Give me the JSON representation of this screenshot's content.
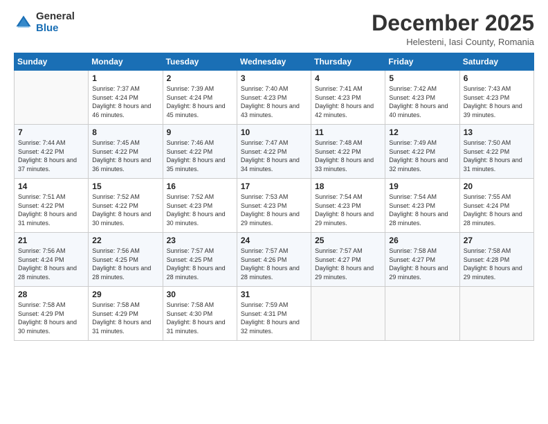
{
  "logo": {
    "general": "General",
    "blue": "Blue"
  },
  "title": "December 2025",
  "location": "Helesteni, Iasi County, Romania",
  "days_of_week": [
    "Sunday",
    "Monday",
    "Tuesday",
    "Wednesday",
    "Thursday",
    "Friday",
    "Saturday"
  ],
  "weeks": [
    [
      {
        "day": "",
        "sunrise": "",
        "sunset": "",
        "daylight": ""
      },
      {
        "day": "1",
        "sunrise": "Sunrise: 7:37 AM",
        "sunset": "Sunset: 4:24 PM",
        "daylight": "Daylight: 8 hours and 46 minutes."
      },
      {
        "day": "2",
        "sunrise": "Sunrise: 7:39 AM",
        "sunset": "Sunset: 4:24 PM",
        "daylight": "Daylight: 8 hours and 45 minutes."
      },
      {
        "day": "3",
        "sunrise": "Sunrise: 7:40 AM",
        "sunset": "Sunset: 4:23 PM",
        "daylight": "Daylight: 8 hours and 43 minutes."
      },
      {
        "day": "4",
        "sunrise": "Sunrise: 7:41 AM",
        "sunset": "Sunset: 4:23 PM",
        "daylight": "Daylight: 8 hours and 42 minutes."
      },
      {
        "day": "5",
        "sunrise": "Sunrise: 7:42 AM",
        "sunset": "Sunset: 4:23 PM",
        "daylight": "Daylight: 8 hours and 40 minutes."
      },
      {
        "day": "6",
        "sunrise": "Sunrise: 7:43 AM",
        "sunset": "Sunset: 4:23 PM",
        "daylight": "Daylight: 8 hours and 39 minutes."
      }
    ],
    [
      {
        "day": "7",
        "sunrise": "Sunrise: 7:44 AM",
        "sunset": "Sunset: 4:22 PM",
        "daylight": "Daylight: 8 hours and 37 minutes."
      },
      {
        "day": "8",
        "sunrise": "Sunrise: 7:45 AM",
        "sunset": "Sunset: 4:22 PM",
        "daylight": "Daylight: 8 hours and 36 minutes."
      },
      {
        "day": "9",
        "sunrise": "Sunrise: 7:46 AM",
        "sunset": "Sunset: 4:22 PM",
        "daylight": "Daylight: 8 hours and 35 minutes."
      },
      {
        "day": "10",
        "sunrise": "Sunrise: 7:47 AM",
        "sunset": "Sunset: 4:22 PM",
        "daylight": "Daylight: 8 hours and 34 minutes."
      },
      {
        "day": "11",
        "sunrise": "Sunrise: 7:48 AM",
        "sunset": "Sunset: 4:22 PM",
        "daylight": "Daylight: 8 hours and 33 minutes."
      },
      {
        "day": "12",
        "sunrise": "Sunrise: 7:49 AM",
        "sunset": "Sunset: 4:22 PM",
        "daylight": "Daylight: 8 hours and 32 minutes."
      },
      {
        "day": "13",
        "sunrise": "Sunrise: 7:50 AM",
        "sunset": "Sunset: 4:22 PM",
        "daylight": "Daylight: 8 hours and 31 minutes."
      }
    ],
    [
      {
        "day": "14",
        "sunrise": "Sunrise: 7:51 AM",
        "sunset": "Sunset: 4:22 PM",
        "daylight": "Daylight: 8 hours and 31 minutes."
      },
      {
        "day": "15",
        "sunrise": "Sunrise: 7:52 AM",
        "sunset": "Sunset: 4:22 PM",
        "daylight": "Daylight: 8 hours and 30 minutes."
      },
      {
        "day": "16",
        "sunrise": "Sunrise: 7:52 AM",
        "sunset": "Sunset: 4:23 PM",
        "daylight": "Daylight: 8 hours and 30 minutes."
      },
      {
        "day": "17",
        "sunrise": "Sunrise: 7:53 AM",
        "sunset": "Sunset: 4:23 PM",
        "daylight": "Daylight: 8 hours and 29 minutes."
      },
      {
        "day": "18",
        "sunrise": "Sunrise: 7:54 AM",
        "sunset": "Sunset: 4:23 PM",
        "daylight": "Daylight: 8 hours and 29 minutes."
      },
      {
        "day": "19",
        "sunrise": "Sunrise: 7:54 AM",
        "sunset": "Sunset: 4:23 PM",
        "daylight": "Daylight: 8 hours and 28 minutes."
      },
      {
        "day": "20",
        "sunrise": "Sunrise: 7:55 AM",
        "sunset": "Sunset: 4:24 PM",
        "daylight": "Daylight: 8 hours and 28 minutes."
      }
    ],
    [
      {
        "day": "21",
        "sunrise": "Sunrise: 7:56 AM",
        "sunset": "Sunset: 4:24 PM",
        "daylight": "Daylight: 8 hours and 28 minutes."
      },
      {
        "day": "22",
        "sunrise": "Sunrise: 7:56 AM",
        "sunset": "Sunset: 4:25 PM",
        "daylight": "Daylight: 8 hours and 28 minutes."
      },
      {
        "day": "23",
        "sunrise": "Sunrise: 7:57 AM",
        "sunset": "Sunset: 4:25 PM",
        "daylight": "Daylight: 8 hours and 28 minutes."
      },
      {
        "day": "24",
        "sunrise": "Sunrise: 7:57 AM",
        "sunset": "Sunset: 4:26 PM",
        "daylight": "Daylight: 8 hours and 28 minutes."
      },
      {
        "day": "25",
        "sunrise": "Sunrise: 7:57 AM",
        "sunset": "Sunset: 4:27 PM",
        "daylight": "Daylight: 8 hours and 29 minutes."
      },
      {
        "day": "26",
        "sunrise": "Sunrise: 7:58 AM",
        "sunset": "Sunset: 4:27 PM",
        "daylight": "Daylight: 8 hours and 29 minutes."
      },
      {
        "day": "27",
        "sunrise": "Sunrise: 7:58 AM",
        "sunset": "Sunset: 4:28 PM",
        "daylight": "Daylight: 8 hours and 29 minutes."
      }
    ],
    [
      {
        "day": "28",
        "sunrise": "Sunrise: 7:58 AM",
        "sunset": "Sunset: 4:29 PM",
        "daylight": "Daylight: 8 hours and 30 minutes."
      },
      {
        "day": "29",
        "sunrise": "Sunrise: 7:58 AM",
        "sunset": "Sunset: 4:29 PM",
        "daylight": "Daylight: 8 hours and 31 minutes."
      },
      {
        "day": "30",
        "sunrise": "Sunrise: 7:58 AM",
        "sunset": "Sunset: 4:30 PM",
        "daylight": "Daylight: 8 hours and 31 minutes."
      },
      {
        "day": "31",
        "sunrise": "Sunrise: 7:59 AM",
        "sunset": "Sunset: 4:31 PM",
        "daylight": "Daylight: 8 hours and 32 minutes."
      },
      {
        "day": "",
        "sunrise": "",
        "sunset": "",
        "daylight": ""
      },
      {
        "day": "",
        "sunrise": "",
        "sunset": "",
        "daylight": ""
      },
      {
        "day": "",
        "sunrise": "",
        "sunset": "",
        "daylight": ""
      }
    ]
  ]
}
